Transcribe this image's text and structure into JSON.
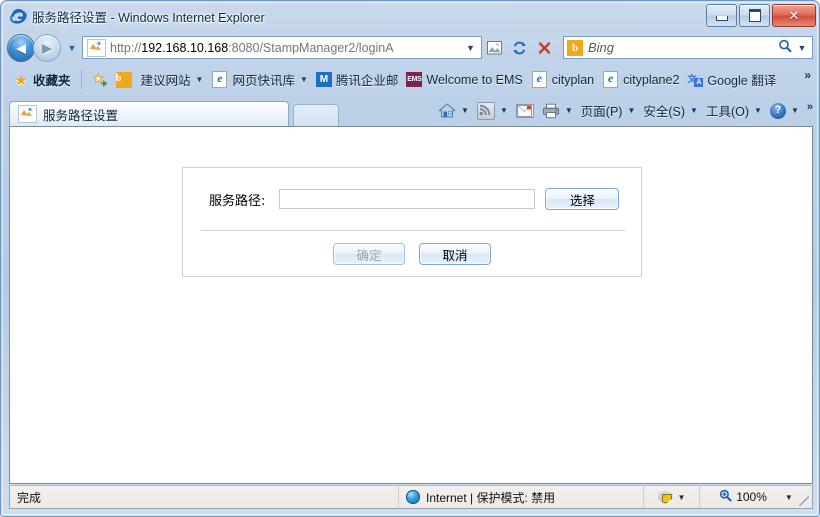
{
  "window": {
    "title": "服务路径设置 - Windows Internet Explorer",
    "app_icon": "ie-logo-icon",
    "controls": {
      "minimize": "minimize-button",
      "maximize": "maximize-button",
      "close": "✕"
    }
  },
  "nav": {
    "back_glyph": "◀",
    "forward_glyph": "▶",
    "history_caret": "▼",
    "address": {
      "url_scheme": "http://",
      "url_host": "192.168.10.168",
      "url_path": ":8080/StampManager2/loginA",
      "full_url": "http://192.168.10.168:8080/StampManager2/loginA",
      "caret": "▼"
    },
    "buttons": [
      {
        "name": "compatibility-view-button",
        "glyph": "▧"
      },
      {
        "name": "refresh-button",
        "glyph": "↻"
      },
      {
        "name": "stop-button",
        "glyph": "✕"
      }
    ],
    "search": {
      "provider": "Bing",
      "provider_mark": "b",
      "placeholder": "Bing",
      "search_glyph": "⌕",
      "caret": "▼"
    }
  },
  "favorites_bar": {
    "favorites_button": {
      "label": "收藏夹",
      "icon": "star-icon"
    },
    "add_to_favorites_icon": "add-favorite-icon",
    "items": [
      {
        "label": "建议网站",
        "icon": "bing-icon",
        "caret": "▼"
      },
      {
        "label": "网页快讯库",
        "icon": "ie-page-icon",
        "caret": "▼"
      },
      {
        "label": "腾讯企业邮",
        "icon": "qq-mail-icon",
        "caret": ""
      },
      {
        "label": "Welcome to EMS",
        "icon": "ems-icon",
        "caret": ""
      },
      {
        "label": "cityplan",
        "icon": "ie-page-icon",
        "caret": ""
      },
      {
        "label": "cityplane2",
        "icon": "ie-page-icon",
        "caret": ""
      },
      {
        "label": "Google 翻译",
        "icon": "google-translate-icon",
        "caret": ""
      }
    ],
    "overflow": "»"
  },
  "tabs": {
    "active": {
      "title": "服务路径设置",
      "icon": "page-favicon"
    },
    "new_tab_label": ""
  },
  "command_bar": {
    "items": [
      {
        "name": "home-button",
        "icon": "home-icon",
        "label": "",
        "caret": "▼"
      },
      {
        "name": "feeds-button",
        "icon": "rss-icon",
        "label": "",
        "caret": "▼"
      },
      {
        "name": "mail-button",
        "icon": "mail-icon",
        "label": "",
        "caret": ""
      },
      {
        "name": "print-button",
        "icon": "printer-icon",
        "label": "",
        "caret": "▼"
      },
      {
        "name": "page-menu",
        "icon": "",
        "label": "页面(P)",
        "caret": "▼"
      },
      {
        "name": "safety-menu",
        "icon": "",
        "label": "安全(S)",
        "caret": "▼"
      },
      {
        "name": "tools-menu",
        "icon": "",
        "label": "工具(O)",
        "caret": "▼"
      },
      {
        "name": "help-menu",
        "icon": "help-icon",
        "label": "",
        "caret": "▼"
      }
    ],
    "overflow": "»"
  },
  "content": {
    "form": {
      "path_label": "服务路径:",
      "path_value": "",
      "path_placeholder": "",
      "browse_button": "选择",
      "ok_button": "确定",
      "ok_disabled": true,
      "cancel_button": "取消"
    }
  },
  "status_bar": {
    "message": "完成",
    "zone": "Internet | 保护模式: 禁用",
    "zone_icon": "internet-zone-icon",
    "protected_icon": "protected-mode-icon",
    "protected_caret": "▼",
    "zoom_level": "100%",
    "zoom_icon": "zoom-magnifier-icon",
    "zoom_caret": "▼"
  },
  "colors": {
    "frame": "#b4cae4",
    "accent": "#1e5fa8",
    "page_bg": "#ffffff",
    "button_border": "#7fa8d6",
    "status_bg": "#efedea"
  }
}
